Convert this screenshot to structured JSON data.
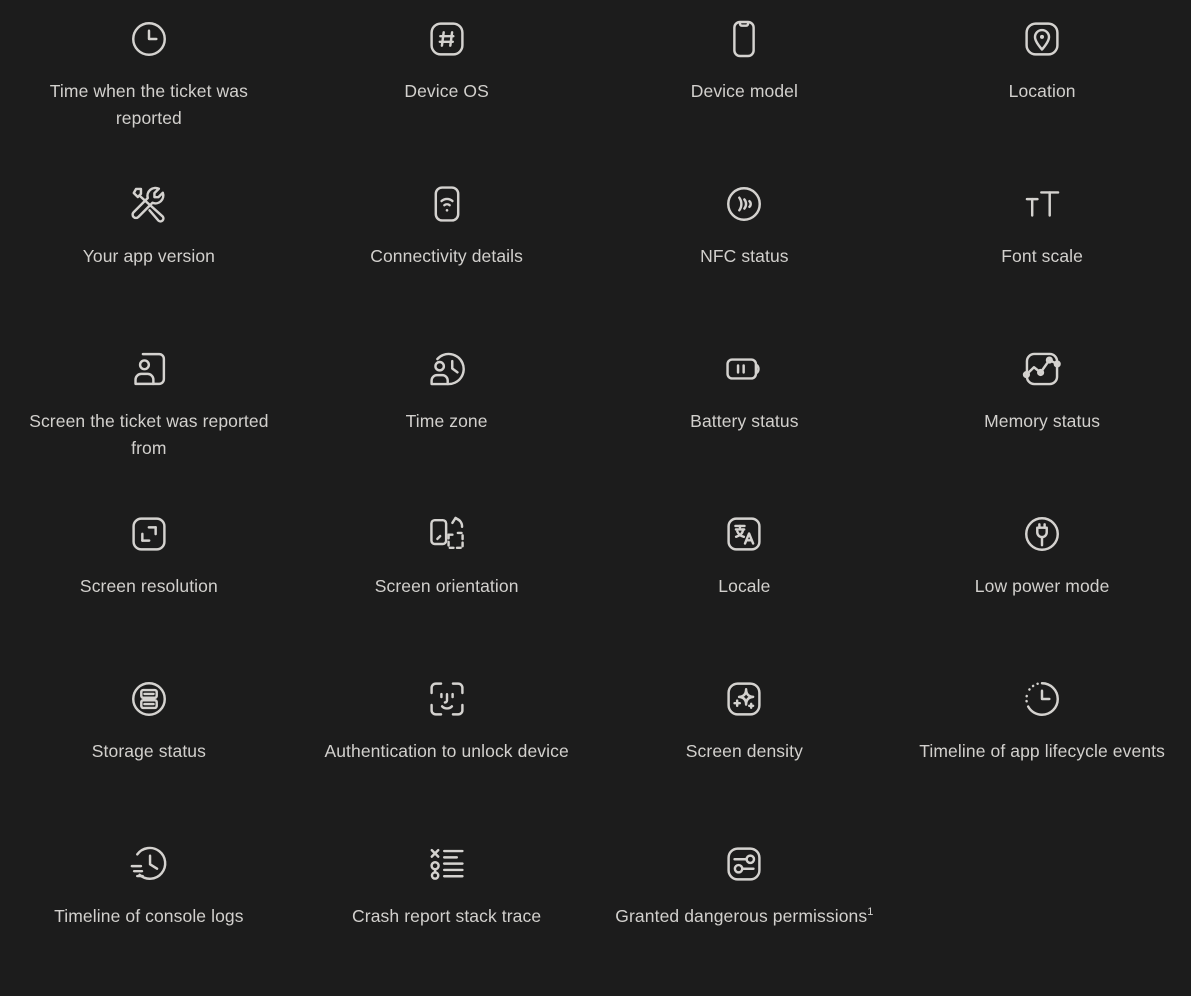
{
  "page": {
    "background_color": "#1c1c1c",
    "icon_color": "#d4d2cf",
    "text_color": "#d2d0cd",
    "columns": 4
  },
  "features": [
    {
      "label": "Time when the ticket was reported",
      "icon": "clock-icon"
    },
    {
      "label": "Device OS",
      "icon": "hash-in-rounded-square-icon"
    },
    {
      "label": "Device model",
      "icon": "phone-icon"
    },
    {
      "label": "Location",
      "icon": "map-pin-in-rounded-square-icon"
    },
    {
      "label": "Your app version",
      "icon": "tools-icon"
    },
    {
      "label": "Connectivity details",
      "icon": "phone-wifi-icon"
    },
    {
      "label": "NFC status",
      "icon": "nfc-waves-icon"
    },
    {
      "label": "Font scale",
      "icon": "font-size-icon"
    },
    {
      "label": "Screen the ticket was reported from",
      "icon": "user-screen-icon"
    },
    {
      "label": "Time zone",
      "icon": "user-clock-icon"
    },
    {
      "label": "Battery status",
      "icon": "battery-icon"
    },
    {
      "label": "Memory status",
      "icon": "memory-chart-icon"
    },
    {
      "label": "Screen resolution",
      "icon": "resize-corners-icon"
    },
    {
      "label": "Screen orientation",
      "icon": "rotate-device-icon"
    },
    {
      "label": "Locale",
      "icon": "translate-icon"
    },
    {
      "label": "Low power mode",
      "icon": "low-power-plug-icon"
    },
    {
      "label": "Storage status",
      "icon": "storage-database-icon"
    },
    {
      "label": "Authentication to unlock device",
      "icon": "face-id-icon"
    },
    {
      "label": "Screen density",
      "icon": "sparkle-icon"
    },
    {
      "label": "Timeline of app lifecycle events",
      "icon": "dotted-clock-icon"
    },
    {
      "label": "Timeline of console logs",
      "icon": "clock-motion-icon"
    },
    {
      "label": "Crash report stack trace",
      "icon": "stack-trace-list-icon"
    },
    {
      "label": "Granted dangerous permissions",
      "icon": "sliders-in-rounded-square-icon",
      "footnote": "1"
    }
  ]
}
